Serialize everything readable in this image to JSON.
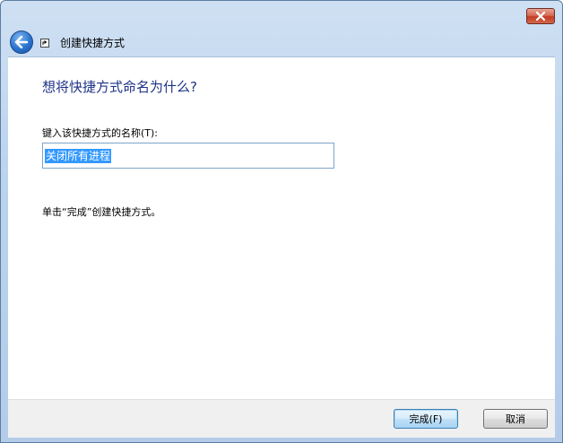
{
  "window": {
    "title": "创建快捷方式"
  },
  "main": {
    "heading": "想将快捷方式命名为什么?",
    "name_label": "键入该快捷方式的名称(T):",
    "name_value": "关闭所有进程",
    "hint": "单击“完成”创建快捷方式。"
  },
  "buttons": {
    "finish": "完成(F)",
    "cancel": "取消"
  },
  "colors": {
    "heading": "#1e3287",
    "selection": "#3399ff",
    "close_button": "#c23c22"
  },
  "icons": {
    "back": "back-arrow-icon",
    "close": "close-icon",
    "shortcut": "shortcut-arrow-icon"
  }
}
